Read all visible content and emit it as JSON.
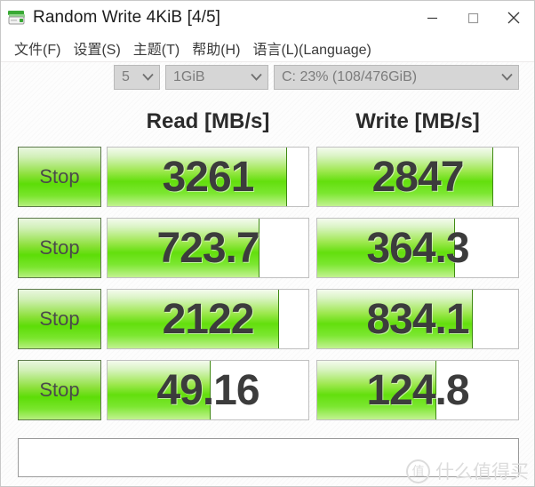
{
  "window": {
    "title": "Random Write 4KiB [4/5]",
    "icon": "disk-drive-icon",
    "controls": {
      "minimize": "minimize-icon",
      "maximize": "maximize-icon",
      "close": "close-icon"
    }
  },
  "menubar": {
    "items": [
      {
        "label": "文件(F)"
      },
      {
        "label": "设置(S)"
      },
      {
        "label": "主题(T)"
      },
      {
        "label": "帮助(H)"
      },
      {
        "label": "语言(L)(Language)"
      }
    ]
  },
  "toolbar": {
    "run_count": "5",
    "test_size": "1GiB",
    "drive": "C: 23% (108/476GiB)",
    "chevron": "chevron-down-icon"
  },
  "headers": {
    "read": "Read [MB/s]",
    "write": "Write [MB/s]"
  },
  "buttons": {
    "stop_label": "Stop"
  },
  "footer": {
    "comment": "",
    "watermark_mark": "值",
    "watermark_text": "什么值得买"
  },
  "colors": {
    "bar_green_bright": "#5ddd07",
    "bar_green_light": "#dbf4c6",
    "bar_edge": "#3f8a12",
    "text_dark": "#3c3c3c",
    "combo_bg": "#d6d6d6",
    "watermark": "#dcdcdc"
  },
  "chart_data": {
    "type": "bar",
    "title": "CrystalDiskMark results",
    "unit": "MB/s",
    "columns": [
      "Read [MB/s]",
      "Write [MB/s]"
    ],
    "rows": [
      {
        "index": 0,
        "read_value": "3261",
        "write_value": "2847",
        "read_fill_pct": 89,
        "write_fill_pct": 87
      },
      {
        "index": 1,
        "read_value": "723.7",
        "write_value": "364.3",
        "read_fill_pct": 75,
        "write_fill_pct": 68
      },
      {
        "index": 2,
        "read_value": "2122",
        "write_value": "834.1",
        "read_fill_pct": 85,
        "write_fill_pct": 77
      },
      {
        "index": 3,
        "read_value": "49.16",
        "write_value": "124.8",
        "read_fill_pct": 51,
        "write_fill_pct": 59
      }
    ]
  }
}
